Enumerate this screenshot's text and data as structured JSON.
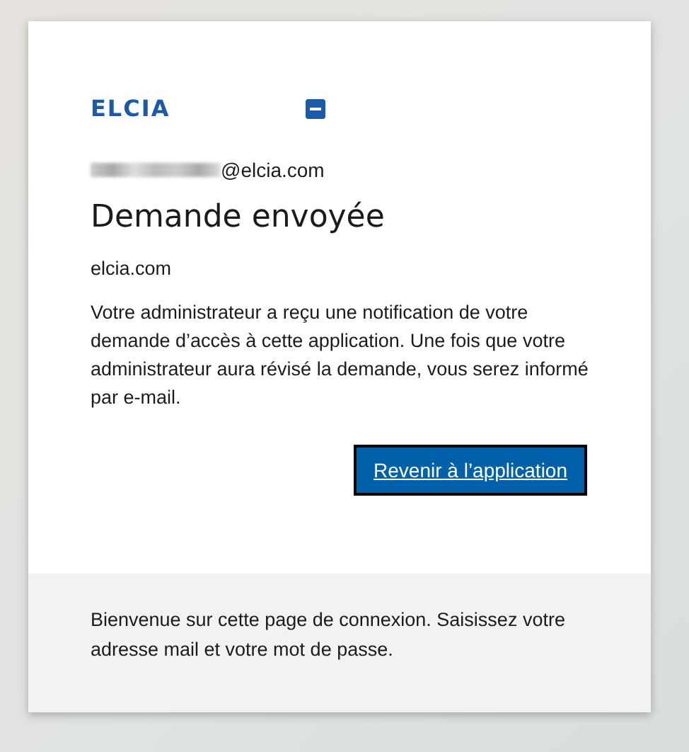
{
  "logo": {
    "text": "ELCIA"
  },
  "account": {
    "email": "@elcia.com"
  },
  "title": "Demande envoyée",
  "domain": "elcia.com",
  "message": "Votre administrateur a reçu une notification de votre demande d’accès à cette application. Une fois que votre administrateur aura révisé la demande, vous serez informé par e-mail.",
  "button": {
    "label": "Revenir à l’application"
  },
  "footer": "Bienvenue sur cette page de connexion. Saisissez votre adresse mail et votre mot de passe."
}
